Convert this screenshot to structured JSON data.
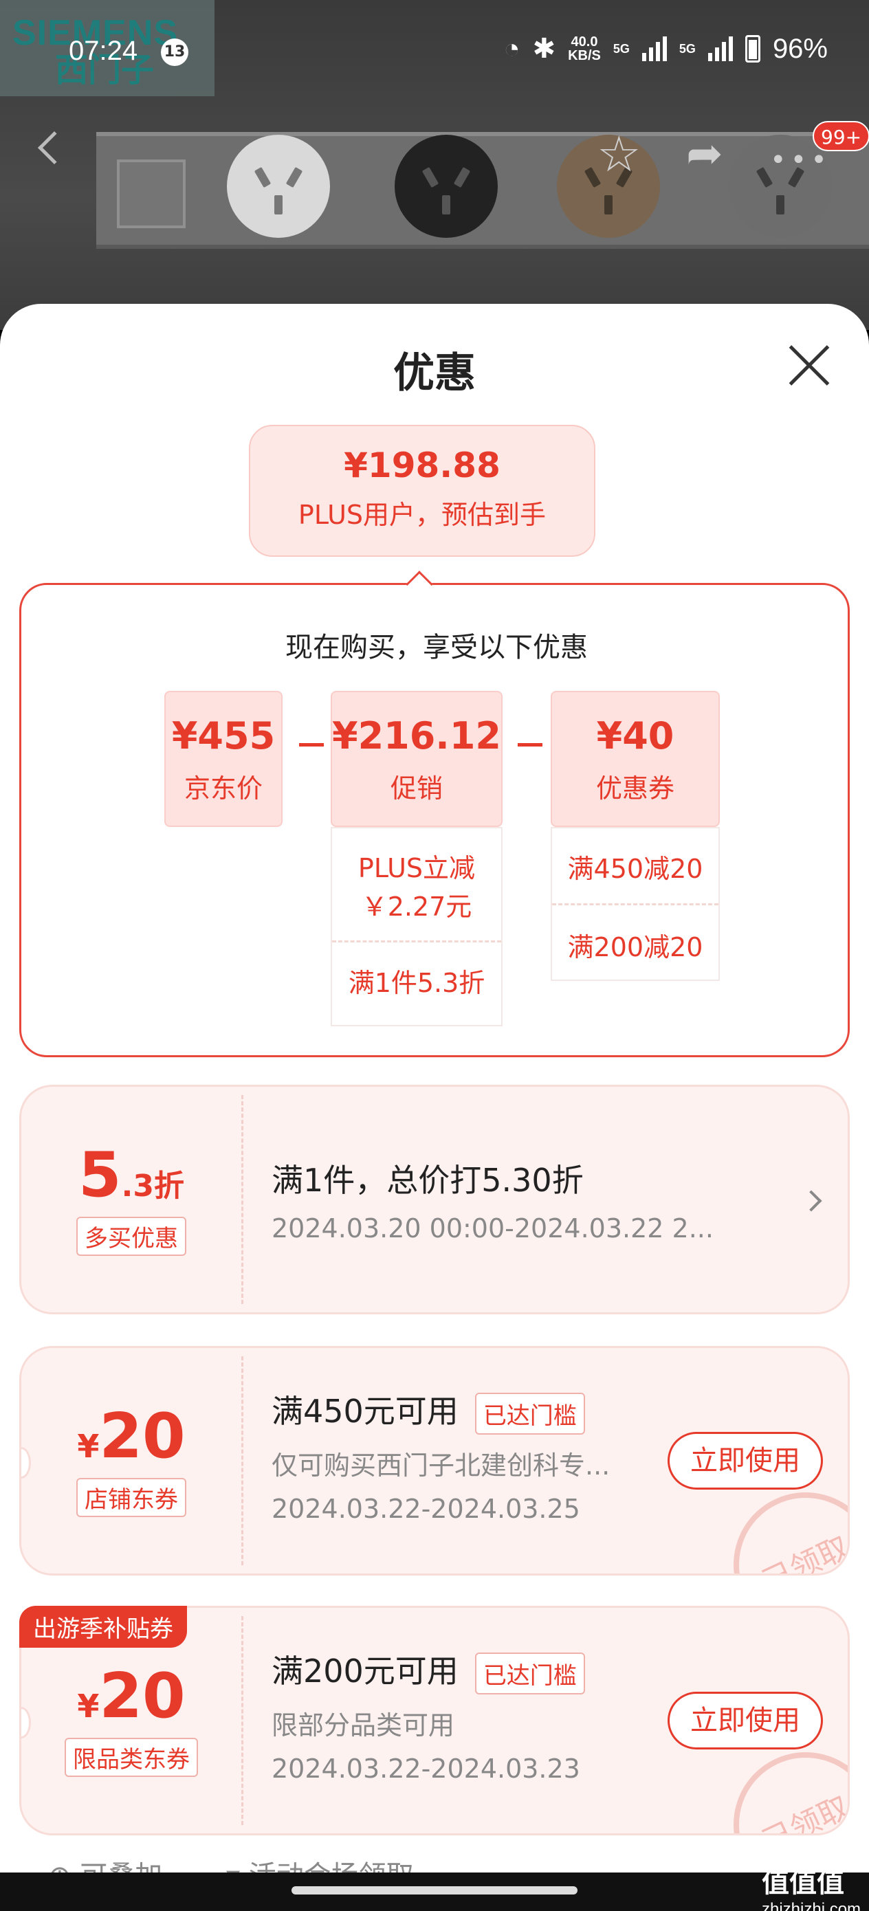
{
  "status_bar": {
    "time": "07:24",
    "notif_count": "13",
    "speed": "40.0",
    "speed_unit": "KB/S",
    "net1": "5G",
    "net2": "5G",
    "battery": "96%"
  },
  "product_image": {
    "brand": "SIEMENS",
    "brand_cn": "西门子"
  },
  "nav": {
    "cart_count": "99+"
  },
  "sheet": {
    "title": "优惠",
    "estimate": {
      "price": "¥198.88",
      "label": "PLUS用户，预估到手"
    },
    "summary": {
      "title": "现在购买，享受以下优惠",
      "jd_price": {
        "value": "¥455",
        "label": "京东价"
      },
      "promotion": {
        "value": "¥216.12",
        "label": "促销",
        "details": [
          "PLUS立减",
          "￥2.27元",
          "满1件5.3折"
        ]
      },
      "coupon": {
        "value": "¥40",
        "label": "优惠券",
        "details": [
          "满450减20",
          "满200减20"
        ]
      },
      "minus": "_"
    },
    "coupons": [
      {
        "amount_big": "5",
        "amount_small": ".3折",
        "tag": "多买优惠",
        "title": "满1件，总价打5.30折",
        "lines": [
          "2024.03.20 00:00-2024.03.22 2..."
        ]
      },
      {
        "currency": "¥",
        "amount_big": "20",
        "tag": "店铺东券",
        "title": "满450元可用",
        "reached": "已达门槛",
        "lines": [
          "仅可购买西门子北建创科专...",
          "2024.03.22-2024.03.25"
        ],
        "button": "立即使用",
        "stamp": "已领取"
      },
      {
        "ribbon": "出游季补贴券",
        "currency": "¥",
        "amount_big": "20",
        "tag": "限品类东券",
        "title": "满200元可用",
        "reached": "已达门槛",
        "lines": [
          "限部分品类可用",
          "2024.03.22-2024.03.23"
        ],
        "button": "立即使用",
        "stamp": "已领取"
      }
    ],
    "footer": {
      "left": "可叠加",
      "right": "活动会场领取"
    }
  },
  "watermark": "值值值",
  "watermark_url": "zhizhizhi.com",
  "colors": {
    "accent": "#e63a2b",
    "pink_bg": "#fee2e0",
    "card_bg": "#fef2f1"
  }
}
